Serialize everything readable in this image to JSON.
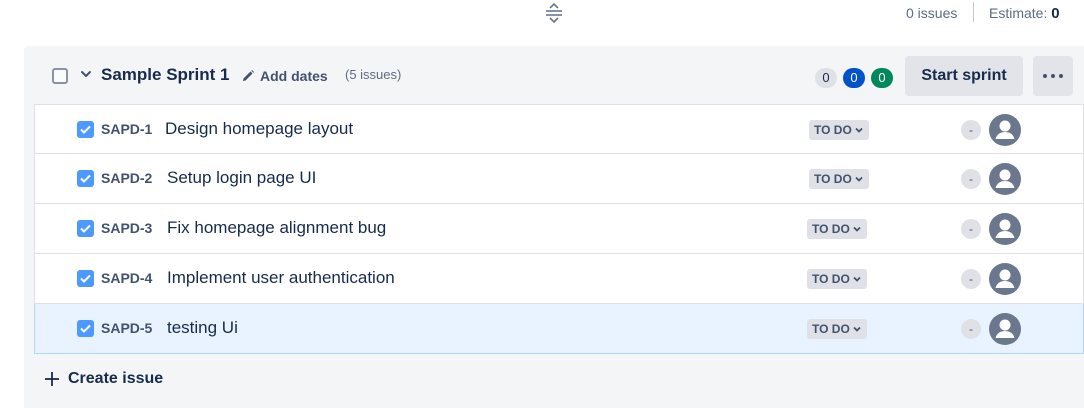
{
  "top": {
    "issue_count": "0 issues",
    "estimate_label": "Estimate:",
    "estimate_value": "0"
  },
  "sprint": {
    "name": "Sample Sprint 1",
    "add_dates_label": "Add dates",
    "issue_count": "(5 issues)",
    "badges": {
      "todo": "0",
      "in_progress": "0",
      "done": "0"
    },
    "start_label": "Start sprint",
    "colors": {
      "todo": "#dfe1e6",
      "in_progress": "#0052cc",
      "done": "#00875a"
    }
  },
  "issues": [
    {
      "key": "SAPD-1",
      "summary": "Design homepage layout",
      "status": "TO DO",
      "estimate": "-"
    },
    {
      "key": "SAPD-2",
      "summary": "Setup login page UI",
      "status": "TO DO",
      "estimate": "-"
    },
    {
      "key": "SAPD-3",
      "summary": "Fix homepage alignment bug",
      "status": "TO DO",
      "estimate": "-"
    },
    {
      "key": "SAPD-4",
      "summary": "Implement user authentication",
      "status": "TO DO",
      "estimate": "-"
    },
    {
      "key": "SAPD-5",
      "summary": "testing Ui",
      "status": "TO DO",
      "estimate": "-"
    }
  ],
  "create_issue_label": "Create issue",
  "icons": {
    "drag": "drag-handle-icon",
    "chevron": "chevron-down-icon",
    "pencil": "pencil-icon",
    "more": "more-icon",
    "checkbox": "checkbox-checked-icon",
    "avatar": "avatar-icon",
    "plus": "plus-icon"
  }
}
